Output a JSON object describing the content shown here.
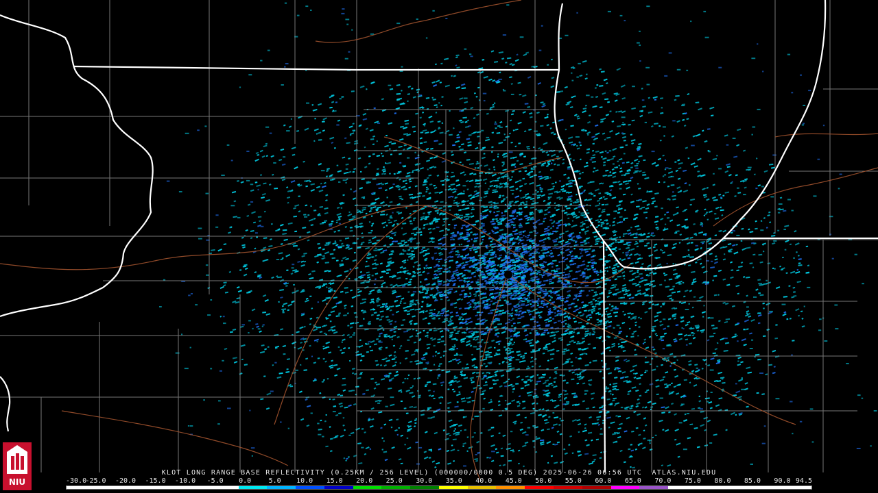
{
  "product": {
    "caption": "KLOT LONG RANGE BASE REFLECTIVITY (0.25KM / 256 LEVEL) (000000/0000 0.5 DEG) 2025-06-26 06:56 UTC  ATLAS.NIU.EDU",
    "station": "KLOT",
    "timestamp": "2025-06-26 06:56 UTC",
    "elevation": "0.5 DEG",
    "source": "ATLAS.NIU.EDU"
  },
  "logo": {
    "text": "NIU",
    "icon": "niu-tower-logo-icon"
  },
  "legend": {
    "labels": [
      "-30.0",
      "-25.0",
      "-20.0",
      "-15.0",
      "-10.0",
      "-5.0",
      "0.0",
      "5.0",
      "10.0",
      "15.0",
      "20.0",
      "25.0",
      "30.0",
      "35.0",
      "40.0",
      "45.0",
      "50.0",
      "55.0",
      "60.0",
      "65.0",
      "70.0",
      "75.0",
      "80.0",
      "85.0",
      "90.0",
      "94.5"
    ],
    "colors": [
      "#ffffff",
      "#ffffff",
      "#ffffff",
      "#ffffff",
      "#ffffff",
      "#ffffff",
      "#00e8f0",
      "#00b4ff",
      "#0050ff",
      "#0000c8",
      "#00e000",
      "#00b000",
      "#008000",
      "#ffff00",
      "#e8c000",
      "#ff9000",
      "#ff0000",
      "#d40000",
      "#b00000",
      "#ff00ff",
      "#9a54c8",
      "#ffffff",
      "#ffffff",
      "#ffffff",
      "#ffffff",
      "#ffffff"
    ]
  },
  "map_colors": {
    "background": "#000000",
    "state_border": "#ffffff",
    "county_line": "#8c8c8c",
    "highway": "#a0522d",
    "echo_primary": "#00c8e0",
    "echo_deep": "#1e6ef0"
  },
  "echo": {
    "radar_site": "KLOT",
    "dominant_dbz": "5.0"
  }
}
